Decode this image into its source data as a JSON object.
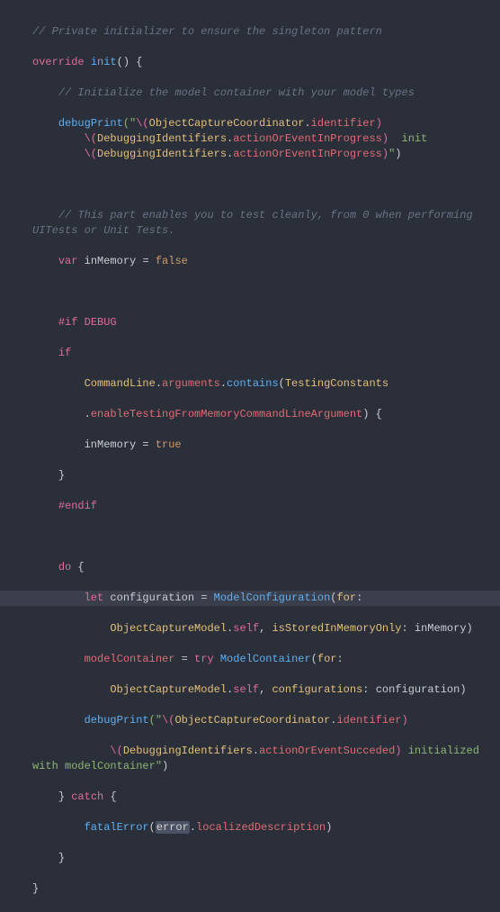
{
  "code": {
    "line1": "// Private initializer to ensure the singleton pattern",
    "override": "override",
    "init": "init",
    "line3": "// Initialize the model container with your model types",
    "debugPrint": "debugPrint",
    "stringOpen": "(\"",
    "escOpen": "\\(",
    "ObjectCaptureCoordinator": "ObjectCaptureCoordinator",
    "identifier": "identifier",
    "DebuggingIdentifiers": "DebuggingIdentifiers",
    "actionOrEventInProgress": "actionOrEventInProgress",
    "initLabel": "init",
    "escClose": ")",
    "stringSpaceClose": "\")",
    "line7": "// This part enables you to test cleanly, from 0 when performing UITests or Unit Tests.",
    "var": "var",
    "inMemory": "inMemory",
    "false": "false",
    "true": "true",
    "ifdebug": "#if DEBUG",
    "endif": "#endif",
    "if": "if",
    "CommandLine": "CommandLine",
    "arguments": "arguments",
    "contains": "contains",
    "TestingConstants": "TestingConstants",
    "enableTestingFromMemoryCommandLineArgument": "enableTestingFromMemoryCommandLineArgument",
    "do": "do",
    "let": "let",
    "configuration": "configuration",
    "ModelConfiguration": "ModelConfiguration",
    "for": "for",
    "ObjectCaptureModel": "ObjectCaptureModel",
    "self": "self",
    "isStoredInMemoryOnly": "isStoredInMemoryOnly",
    "modelContainer": "modelContainer",
    "try": "try",
    "ModelContainer": "ModelContainer",
    "configurations": "configurations",
    "actionOrEventSucceded": "actionOrEventSucceded",
    "initializedWith": "initialized with modelContainer\"",
    "catch": "catch",
    "fatalError": "fatalError",
    "error": "error",
    "localizedDescription": "localizedDescription"
  }
}
